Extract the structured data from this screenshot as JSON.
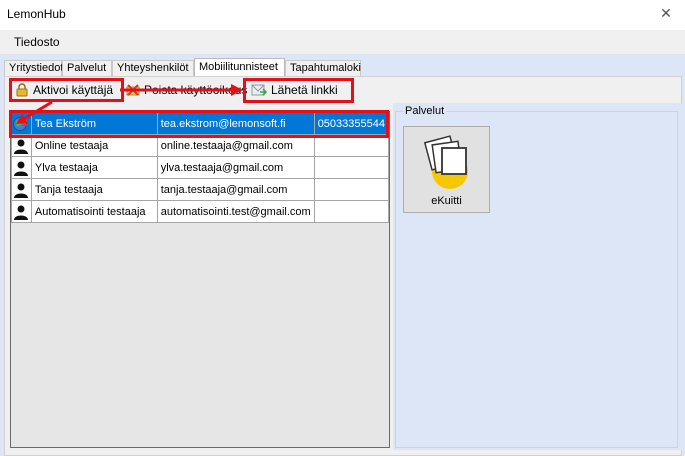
{
  "window": {
    "title": "LemonHub"
  },
  "menu": {
    "items": [
      {
        "label": "Tiedosto"
      }
    ]
  },
  "tabs": [
    {
      "label": "Yritystiedot",
      "active": false
    },
    {
      "label": "Palvelut",
      "active": false
    },
    {
      "label": "Yhteyshenkilöt",
      "active": false
    },
    {
      "label": "Mobiilitunnisteet",
      "active": true
    },
    {
      "label": "Tapahtumaloki",
      "active": false
    }
  ],
  "toolbar": {
    "activate_label": "Aktivoi käyttäjä",
    "remove_label": "Poista käyttöoikeus",
    "send_link_label": "Lähetä linkki"
  },
  "users": [
    {
      "name": "Tea Ekström",
      "email": "tea.ekstrom@lemonsoft.fi",
      "phone": "05033355544",
      "icon": "globe-user-icon",
      "selected": true
    },
    {
      "name": "Online testaaja",
      "email": "online.testaaja@gmail.com",
      "phone": "",
      "icon": "user-icon",
      "selected": false
    },
    {
      "name": "Ylva testaaja",
      "email": "ylva.testaaja@gmail.com",
      "phone": "",
      "icon": "user-icon",
      "selected": false
    },
    {
      "name": "Tanja testaaja",
      "email": "tanja.testaaja@gmail.com",
      "phone": "",
      "icon": "user-icon",
      "selected": false
    },
    {
      "name": "Automatisointi testaaja",
      "email": "automatisointi.test@gmail.com",
      "phone": "",
      "icon": "user-icon",
      "selected": false
    }
  ],
  "services": {
    "title": "Palvelut",
    "items": [
      {
        "label": "eKuitti",
        "icon": "ekuitti-icon"
      }
    ]
  },
  "colors": {
    "highlight": "#e3101a",
    "selection": "#0078d7",
    "panel_bg": "#dde6f6"
  }
}
